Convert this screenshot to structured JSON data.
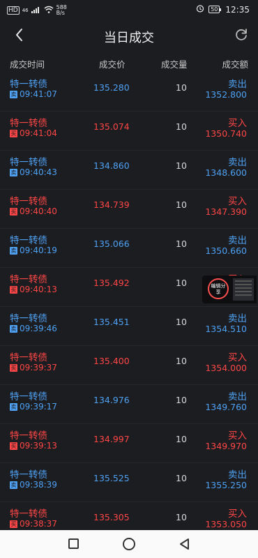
{
  "status_bar": {
    "left_text": "HD",
    "signal_text": "46",
    "speed_value": "588",
    "speed_unit": "B/s",
    "battery": "50",
    "time": "12:35"
  },
  "header": {
    "title": "当日成交"
  },
  "columns": {
    "time": "成交时间",
    "price": "成交价",
    "volume": "成交量",
    "amount": "成交额"
  },
  "trades": [
    {
      "name": "特一转债",
      "tag": "卖",
      "time": "09:41:07",
      "price": "135.280",
      "volume": "10",
      "side": "卖出",
      "amount": "1352.800",
      "type": "sell"
    },
    {
      "name": "特一转债",
      "tag": "买",
      "time": "09:41:04",
      "price": "135.074",
      "volume": "10",
      "side": "买入",
      "amount": "1350.740",
      "type": "buy"
    },
    {
      "name": "特一转债",
      "tag": "卖",
      "time": "09:40:43",
      "price": "134.860",
      "volume": "10",
      "side": "卖出",
      "amount": "1348.600",
      "type": "sell"
    },
    {
      "name": "特一转债",
      "tag": "买",
      "time": "09:40:40",
      "price": "134.739",
      "volume": "10",
      "side": "买入",
      "amount": "1347.390",
      "type": "buy"
    },
    {
      "name": "特一转债",
      "tag": "卖",
      "time": "09:40:19",
      "price": "135.066",
      "volume": "10",
      "side": "卖出",
      "amount": "1350.660",
      "type": "sell"
    },
    {
      "name": "特一转债",
      "tag": "买",
      "time": "09:40:13",
      "price": "135.492",
      "volume": "10",
      "side": "买入",
      "amount": "",
      "type": "buy"
    },
    {
      "name": "特一转债",
      "tag": "卖",
      "time": "09:39:46",
      "price": "135.451",
      "volume": "10",
      "side": "卖出",
      "amount": "1354.510",
      "type": "sell"
    },
    {
      "name": "特一转债",
      "tag": "买",
      "time": "09:39:37",
      "price": "135.400",
      "volume": "10",
      "side": "买入",
      "amount": "1354.000",
      "type": "buy"
    },
    {
      "name": "特一转债",
      "tag": "卖",
      "time": "09:39:17",
      "price": "134.976",
      "volume": "10",
      "side": "卖出",
      "amount": "1349.760",
      "type": "sell"
    },
    {
      "name": "特一转债",
      "tag": "买",
      "time": "09:39:13",
      "price": "134.997",
      "volume": "10",
      "side": "买入",
      "amount": "1349.970",
      "type": "buy"
    },
    {
      "name": "特一转债",
      "tag": "卖",
      "time": "09:38:39",
      "price": "135.525",
      "volume": "10",
      "side": "卖出",
      "amount": "1355.250",
      "type": "sell"
    },
    {
      "name": "特一转债",
      "tag": "买",
      "time": "09:38:37",
      "price": "135.305",
      "volume": "10",
      "side": "买入",
      "amount": "1353.050",
      "type": "buy"
    }
  ],
  "float_widget": {
    "label": "编辑分享"
  },
  "colors": {
    "buy": "#ff4646",
    "sell": "#4ea1f3",
    "background": "#1c1d21"
  },
  "icons": {
    "back": "back-arrow-icon",
    "refresh": "refresh-icon"
  }
}
